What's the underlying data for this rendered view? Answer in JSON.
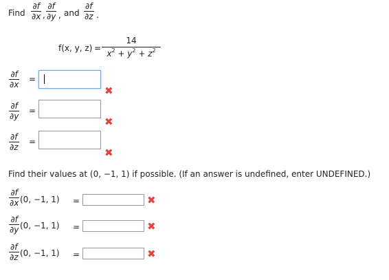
{
  "prompt": {
    "find_word": "Find",
    "numerator": "∂f",
    "den_x": "∂x",
    "den_y": "∂y",
    "den_z": "∂z",
    "comma": ",",
    "and_word": "and",
    "period": "."
  },
  "function": {
    "lhs": "f(x, y, z)",
    "equals": "=",
    "numerator": "14",
    "den_x": "x",
    "den_y": "y",
    "den_z": "z",
    "plus": "+",
    "exponent": "2"
  },
  "partials": [
    {
      "num": "∂f",
      "den": "∂x",
      "equals": "=",
      "value": ""
    },
    {
      "num": "∂f",
      "den": "∂y",
      "equals": "=",
      "value": ""
    },
    {
      "num": "∂f",
      "den": "∂z",
      "equals": "=",
      "value": ""
    }
  ],
  "instruction": "Find their values at (0, −1, 1) if possible. (If an answer is undefined, enter UNDEFINED.)",
  "evaluations": [
    {
      "num": "∂f",
      "den": "∂x",
      "point": "(0, −1, 1)",
      "equals": "=",
      "value": ""
    },
    {
      "num": "∂f",
      "den": "∂y",
      "point": "(0, −1, 1)",
      "equals": "=",
      "value": ""
    },
    {
      "num": "∂f",
      "den": "∂z",
      "point": "(0, −1, 1)",
      "equals": "=",
      "value": ""
    }
  ],
  "status_icon": "incorrect-x-icon",
  "status_glyph": "✖",
  "colors": {
    "incorrect": "#e0443f",
    "focus_border": "#7aa7d8"
  }
}
